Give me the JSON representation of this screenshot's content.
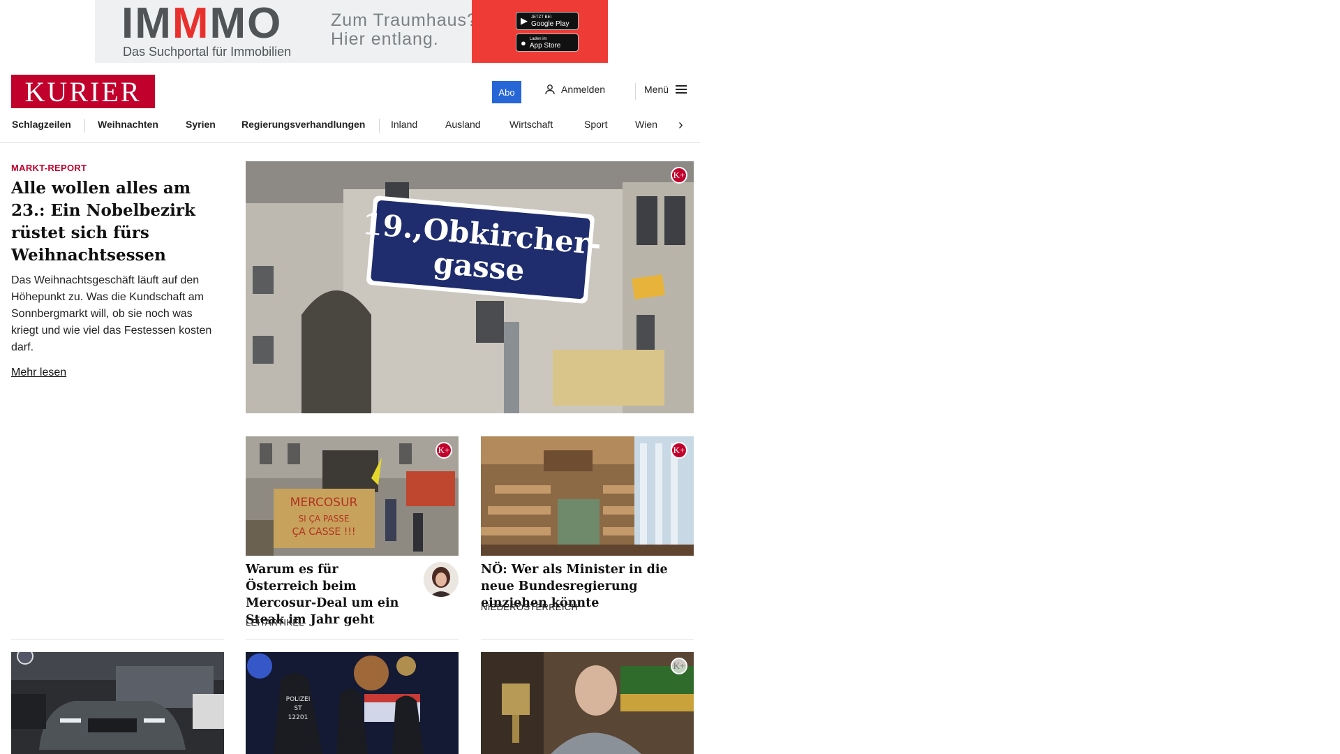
{
  "ad": {
    "brand_left": "IM",
    "brand_mid": "M",
    "brand_right": "MO",
    "subline": "Das Suchportal für Immobilien",
    "claim_line1": "Zum Traumhaus?",
    "claim_line2": "Hier entlang.",
    "google_small": "JETZT BEI",
    "google_label": "Google Play",
    "apple_small": "Laden im",
    "apple_label": "App Store",
    "colors": {
      "accent": "#ef3b36",
      "text": "#505456"
    }
  },
  "header": {
    "logo": "KURIER",
    "abo": "Abo",
    "login": "Anmelden",
    "menu": "Menü",
    "colors": {
      "brand": "#c1002b",
      "abo": "#2766d6"
    }
  },
  "nav": {
    "items": [
      "Schlagzeilen",
      "Weihnachten",
      "Syrien",
      "Regierungsverhandlungen",
      "Inland",
      "Ausland",
      "Wirtschaft",
      "Sport",
      "Wien"
    ],
    "next_icon": "chevron-right-icon"
  },
  "lead": {
    "kicker": "MARKT-REPORT",
    "title": "Alle wollen alles am 23.: Ein Nobelbezirk rüstet sich fürs Weihnachtsessen",
    "text": "Das Weihnachtsgeschäft läuft auf den Höhepunkt zu. Was die Kundschaft am Sonnbergmarkt will, ob sie noch was kriegt und wie viel das Festessen kosten darf.",
    "more": "Mehr lesen",
    "image_sign_line1": "19.,Obkircher-",
    "image_sign_line2": "gasse",
    "badge": "K+"
  },
  "teasers": [
    {
      "title": "Warum es für Österreich beim Mercosur-Deal um ein Steak im Jahr geht",
      "category": "LEITARTIKEL",
      "badge": "K+",
      "image_sign_line1": "MERCOSUR",
      "image_sign_line2": "SI ÇA PASSE",
      "image_sign_line3": "ÇA CASSE !!!"
    },
    {
      "title": "NÖ: Wer als Minister in die neue Bundesregierung einziehen könnte",
      "category": "NIEDERÖSTERREICH",
      "badge": "K+"
    }
  ],
  "bottom": {
    "police_label1": "POLIZEI",
    "police_label2": "ST",
    "police_label3": "12201",
    "badge_light": "K+"
  }
}
